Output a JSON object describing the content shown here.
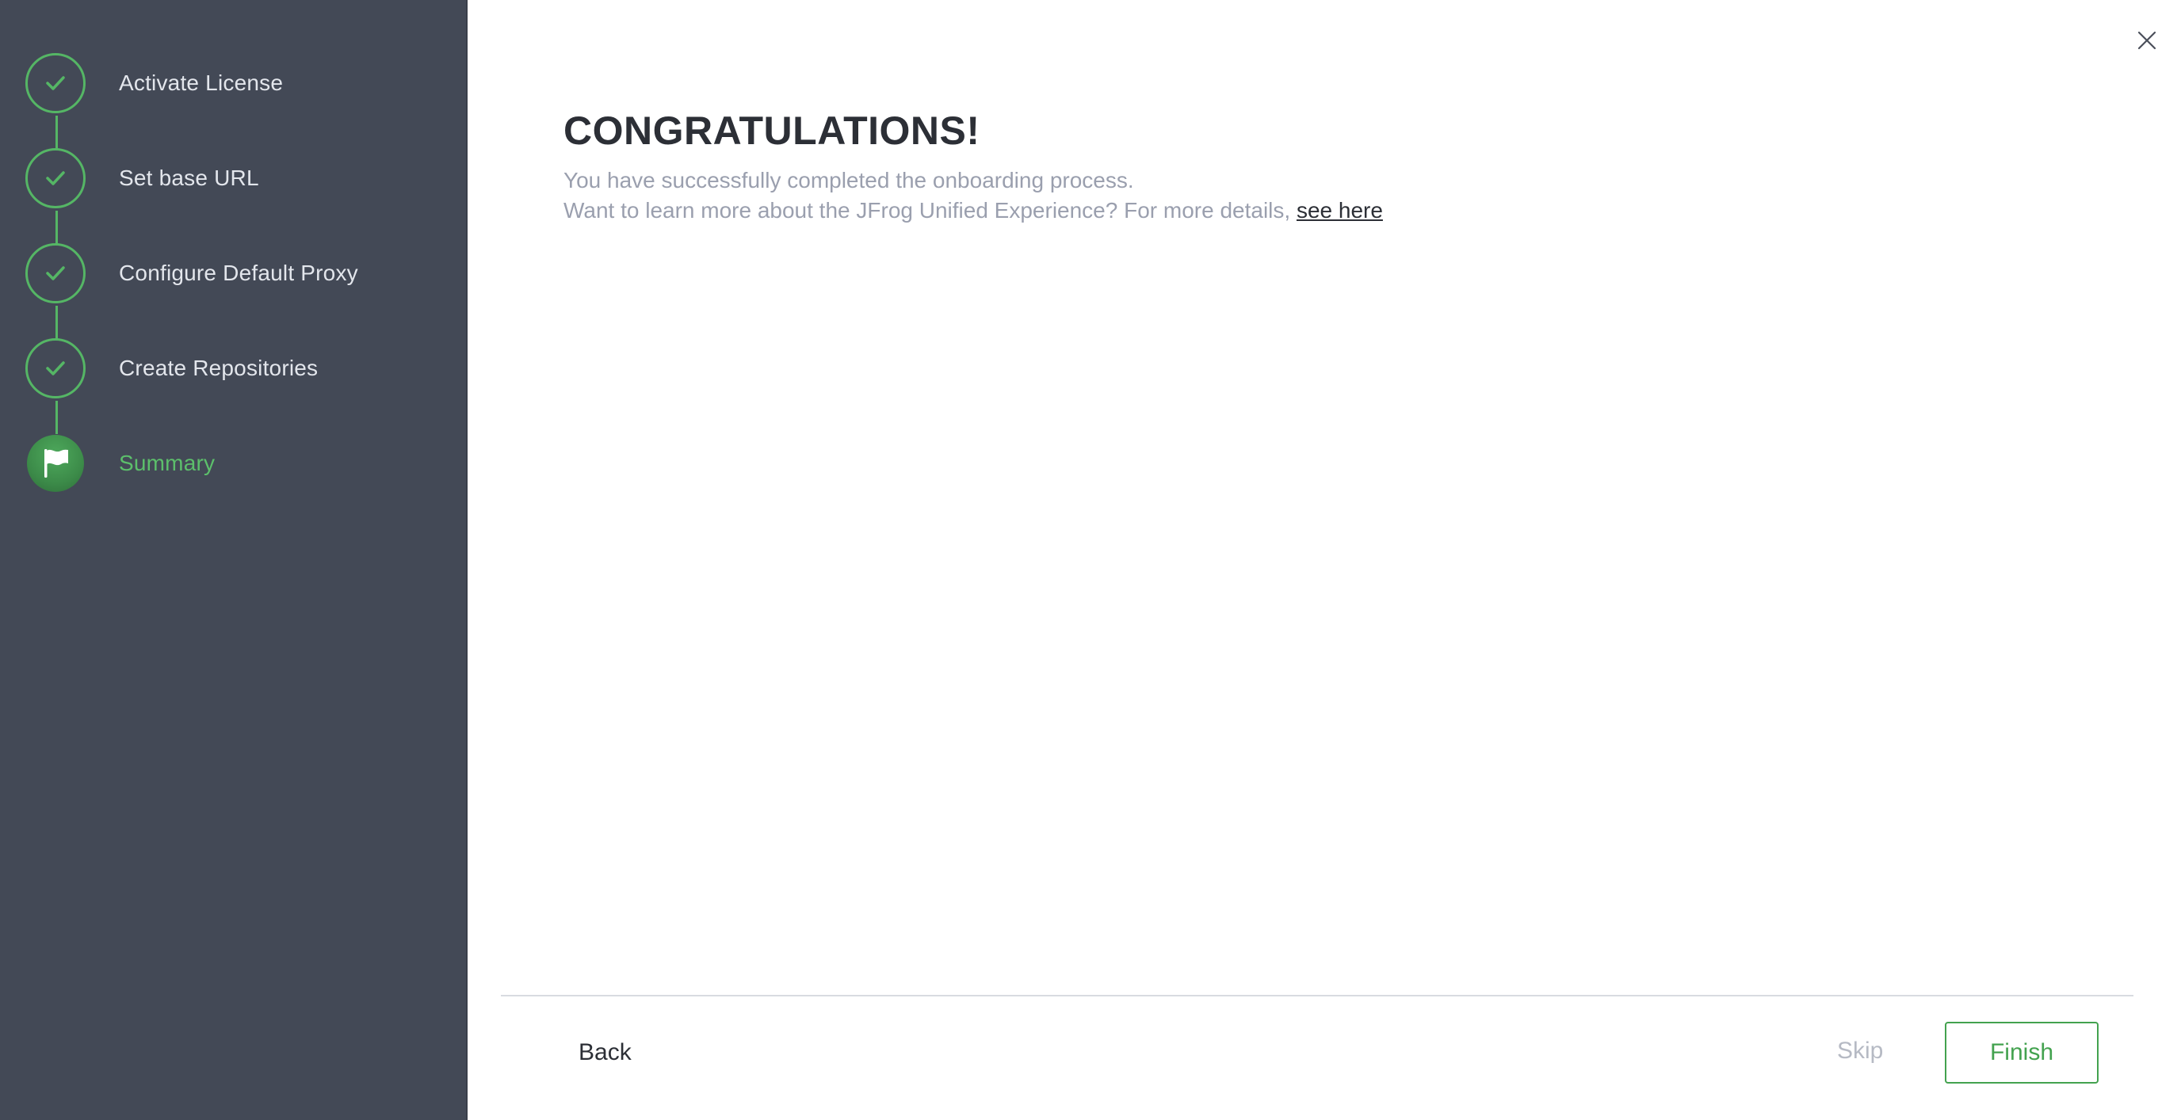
{
  "sidebar": {
    "steps": [
      {
        "label": "Activate License",
        "status": "completed",
        "icon": "check-icon"
      },
      {
        "label": "Set base URL",
        "status": "completed",
        "icon": "check-icon"
      },
      {
        "label": "Configure Default Proxy",
        "status": "completed",
        "icon": "check-icon"
      },
      {
        "label": "Create Repositories",
        "status": "completed",
        "icon": "check-icon"
      },
      {
        "label": "Summary",
        "status": "active",
        "icon": "flag-icon"
      }
    ]
  },
  "main": {
    "title": "CONGRATULATIONS!",
    "line1": "You have successfully completed the onboarding process.",
    "line2_text": "Want to learn more about the JFrog Unified Experience? For more details, ",
    "line2_link": "see here",
    "close_icon": "close-icon"
  },
  "footer": {
    "back_label": "Back",
    "skip_label": "Skip",
    "finish_label": "Finish"
  },
  "colors": {
    "sidebar_bg": "#434956",
    "accent_green": "#55b665",
    "finish_green": "#43a24f",
    "title_text": "#2c2f36",
    "muted_text": "#9a9fae"
  }
}
